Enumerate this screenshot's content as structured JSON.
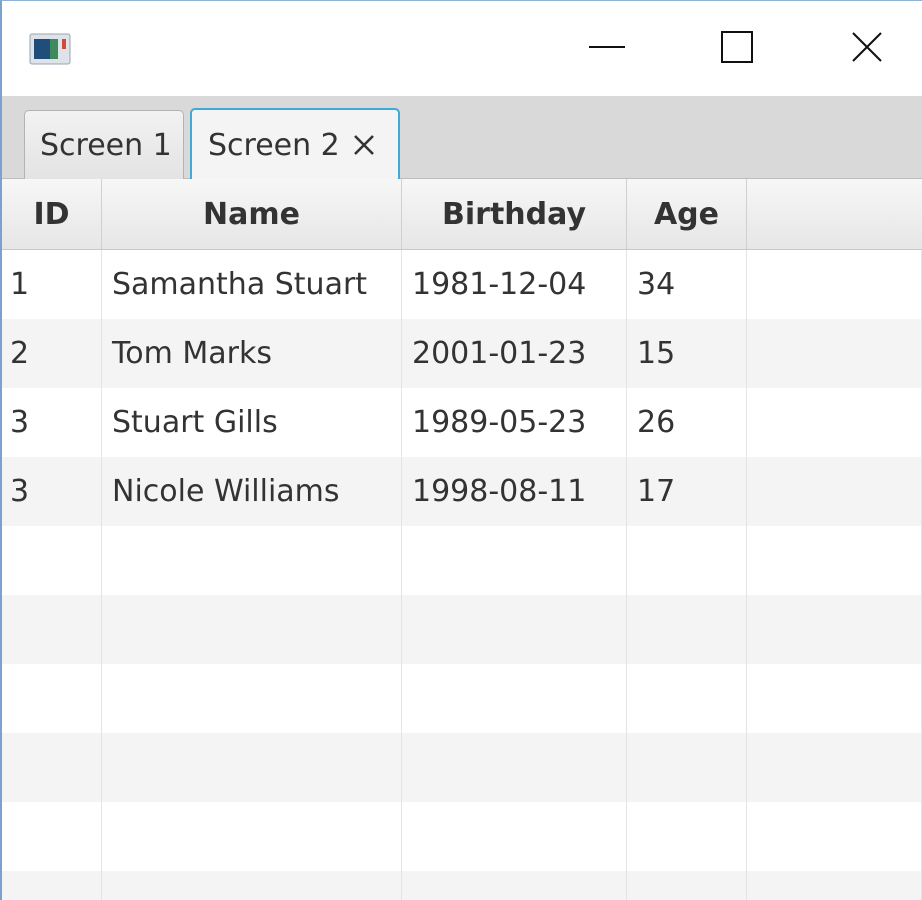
{
  "window": {
    "icon": "java-app-icon",
    "controls": {
      "minimize": "minimize-icon",
      "maximize": "maximize-icon",
      "close": "close-icon"
    }
  },
  "tabs": [
    {
      "label": "Screen 1",
      "selected": false,
      "closable": false
    },
    {
      "label": "Screen 2",
      "selected": true,
      "closable": true
    }
  ],
  "table": {
    "columns": [
      "ID",
      "Name",
      "Birthday",
      "Age"
    ],
    "rows": [
      [
        "1",
        "Samantha Stuart",
        "1981-12-04",
        "34"
      ],
      [
        "2",
        "Tom Marks",
        "2001-01-23",
        "15"
      ],
      [
        "3",
        "Stuart Gills",
        "1989-05-23",
        "26"
      ],
      [
        "3",
        "Nicole Williams",
        "1998-08-11",
        "17"
      ]
    ]
  },
  "colors": {
    "selected_tab_border": "#3fa9d8",
    "window_border": "#7aa3cc",
    "tab_bar": "#d9d9d9",
    "row_alt": "#f4f4f4"
  }
}
